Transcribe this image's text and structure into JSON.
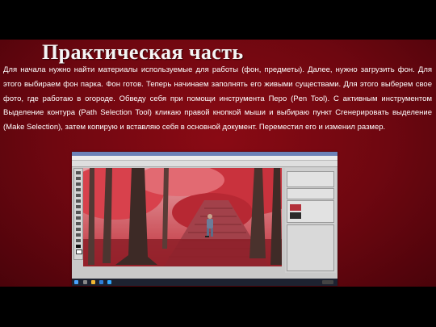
{
  "slide": {
    "title": "Практическая часть",
    "paragraph": "Для начала нужно найти материалы используемые для работы (фон, предметы). Далее, нужно загрузить фон. Для этого выбираем фон парка. Фон готов. Теперь начинаем заполнять его живыми существами. Для этого выберем свое фото, где работаю в огороде. Обведу себя при помощи инструмента Перо (Pen Tool). С активным инструментом Выделение контура (Path Selection Tool) кликаю правой кнопкой мыши и выбираю пункт Сгенерировать выделение (Make Selection), затем копирую и вставляю себя в основной документ. Переместил его и изменил размер."
  },
  "screenshot": {
    "description_icons": [
      "photoshop-toolbox",
      "layers-panel",
      "taskbar"
    ],
    "colors": {
      "slide_bg": "#6e0710",
      "title_text": "#f4f4f4",
      "body_text": "#ffffff",
      "canvas_foliage": "#c8323a",
      "taskbar": "#1d2230"
    }
  }
}
